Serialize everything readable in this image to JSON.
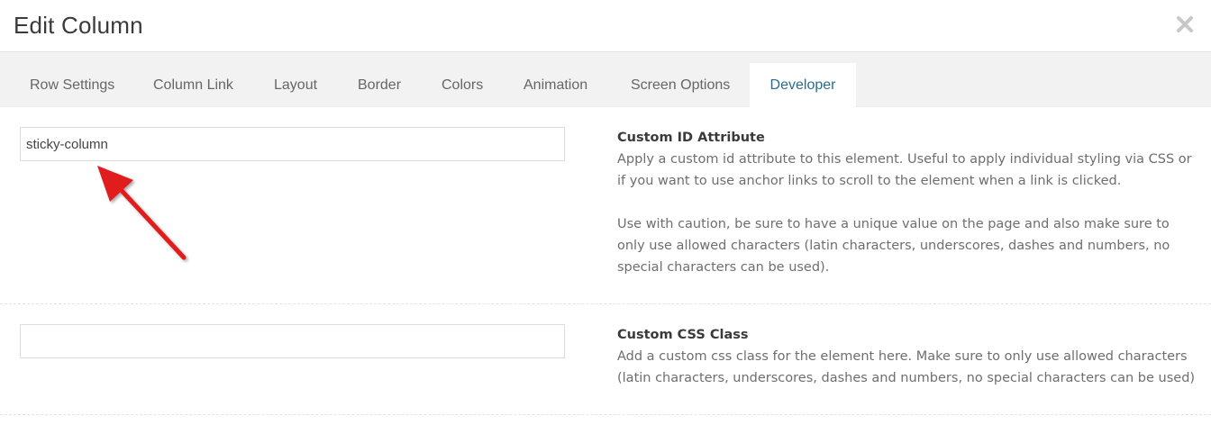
{
  "modal": {
    "title": "Edit Column"
  },
  "tabs": [
    {
      "label": "Row Settings",
      "active": false
    },
    {
      "label": "Column Link",
      "active": false
    },
    {
      "label": "Layout",
      "active": false
    },
    {
      "label": "Border",
      "active": false
    },
    {
      "label": "Colors",
      "active": false
    },
    {
      "label": "Animation",
      "active": false
    },
    {
      "label": "Screen Options",
      "active": false
    },
    {
      "label": "Developer",
      "active": true
    }
  ],
  "fields": {
    "custom_id": {
      "value": "sticky-column",
      "title": "Custom ID Attribute",
      "description": "Apply a custom id attribute to this element. Useful to apply individual styling via CSS or if you want to use anchor links to scroll to the element when a link is clicked.",
      "caution": "Use with caution, be sure to have a unique value on the page and also make sure to only use allowed characters (latin characters, underscores, dashes and numbers, no special characters can be used)."
    },
    "custom_css": {
      "value": "",
      "title": "Custom CSS Class",
      "description": "Add a custom css class for the element here. Make sure to only use allowed characters (latin characters, underscores, dashes and numbers, no special characters can be used)"
    }
  },
  "colors": {
    "active_tab_text": "#2b6c8c",
    "arrow": "#e01e1e"
  },
  "icons": {
    "close": "close-icon",
    "annotation_arrow": "annotation-arrow-icon"
  }
}
